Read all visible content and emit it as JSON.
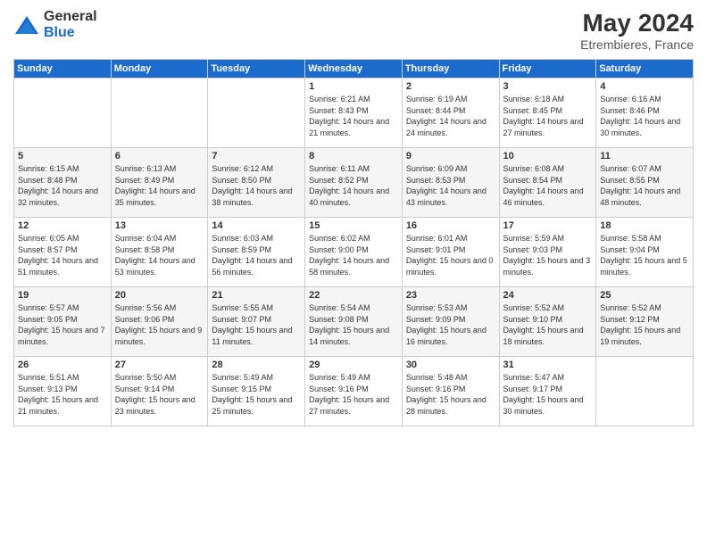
{
  "logo": {
    "general": "General",
    "blue": "Blue"
  },
  "header": {
    "month": "May 2024",
    "location": "Etrembieres, France"
  },
  "weekdays": [
    "Sunday",
    "Monday",
    "Tuesday",
    "Wednesday",
    "Thursday",
    "Friday",
    "Saturday"
  ],
  "weeks": [
    {
      "days": [
        {
          "num": "",
          "info": ""
        },
        {
          "num": "",
          "info": ""
        },
        {
          "num": "",
          "info": ""
        },
        {
          "num": "1",
          "info": "Sunrise: 6:21 AM\nSunset: 8:43 PM\nDaylight: 14 hours\nand 21 minutes."
        },
        {
          "num": "2",
          "info": "Sunrise: 6:19 AM\nSunset: 8:44 PM\nDaylight: 14 hours\nand 24 minutes."
        },
        {
          "num": "3",
          "info": "Sunrise: 6:18 AM\nSunset: 8:45 PM\nDaylight: 14 hours\nand 27 minutes."
        },
        {
          "num": "4",
          "info": "Sunrise: 6:16 AM\nSunset: 8:46 PM\nDaylight: 14 hours\nand 30 minutes."
        }
      ]
    },
    {
      "days": [
        {
          "num": "5",
          "info": "Sunrise: 6:15 AM\nSunset: 8:48 PM\nDaylight: 14 hours\nand 32 minutes."
        },
        {
          "num": "6",
          "info": "Sunrise: 6:13 AM\nSunset: 8:49 PM\nDaylight: 14 hours\nand 35 minutes."
        },
        {
          "num": "7",
          "info": "Sunrise: 6:12 AM\nSunset: 8:50 PM\nDaylight: 14 hours\nand 38 minutes."
        },
        {
          "num": "8",
          "info": "Sunrise: 6:11 AM\nSunset: 8:52 PM\nDaylight: 14 hours\nand 40 minutes."
        },
        {
          "num": "9",
          "info": "Sunrise: 6:09 AM\nSunset: 8:53 PM\nDaylight: 14 hours\nand 43 minutes."
        },
        {
          "num": "10",
          "info": "Sunrise: 6:08 AM\nSunset: 8:54 PM\nDaylight: 14 hours\nand 46 minutes."
        },
        {
          "num": "11",
          "info": "Sunrise: 6:07 AM\nSunset: 8:55 PM\nDaylight: 14 hours\nand 48 minutes."
        }
      ]
    },
    {
      "days": [
        {
          "num": "12",
          "info": "Sunrise: 6:05 AM\nSunset: 8:57 PM\nDaylight: 14 hours\nand 51 minutes."
        },
        {
          "num": "13",
          "info": "Sunrise: 6:04 AM\nSunset: 8:58 PM\nDaylight: 14 hours\nand 53 minutes."
        },
        {
          "num": "14",
          "info": "Sunrise: 6:03 AM\nSunset: 8:59 PM\nDaylight: 14 hours\nand 56 minutes."
        },
        {
          "num": "15",
          "info": "Sunrise: 6:02 AM\nSunset: 9:00 PM\nDaylight: 14 hours\nand 58 minutes."
        },
        {
          "num": "16",
          "info": "Sunrise: 6:01 AM\nSunset: 9:01 PM\nDaylight: 15 hours\nand 0 minutes."
        },
        {
          "num": "17",
          "info": "Sunrise: 5:59 AM\nSunset: 9:03 PM\nDaylight: 15 hours\nand 3 minutes."
        },
        {
          "num": "18",
          "info": "Sunrise: 5:58 AM\nSunset: 9:04 PM\nDaylight: 15 hours\nand 5 minutes."
        }
      ]
    },
    {
      "days": [
        {
          "num": "19",
          "info": "Sunrise: 5:57 AM\nSunset: 9:05 PM\nDaylight: 15 hours\nand 7 minutes."
        },
        {
          "num": "20",
          "info": "Sunrise: 5:56 AM\nSunset: 9:06 PM\nDaylight: 15 hours\nand 9 minutes."
        },
        {
          "num": "21",
          "info": "Sunrise: 5:55 AM\nSunset: 9:07 PM\nDaylight: 15 hours\nand 11 minutes."
        },
        {
          "num": "22",
          "info": "Sunrise: 5:54 AM\nSunset: 9:08 PM\nDaylight: 15 hours\nand 14 minutes."
        },
        {
          "num": "23",
          "info": "Sunrise: 5:53 AM\nSunset: 9:09 PM\nDaylight: 15 hours\nand 16 minutes."
        },
        {
          "num": "24",
          "info": "Sunrise: 5:52 AM\nSunset: 9:10 PM\nDaylight: 15 hours\nand 18 minutes."
        },
        {
          "num": "25",
          "info": "Sunrise: 5:52 AM\nSunset: 9:12 PM\nDaylight: 15 hours\nand 19 minutes."
        }
      ]
    },
    {
      "days": [
        {
          "num": "26",
          "info": "Sunrise: 5:51 AM\nSunset: 9:13 PM\nDaylight: 15 hours\nand 21 minutes."
        },
        {
          "num": "27",
          "info": "Sunrise: 5:50 AM\nSunset: 9:14 PM\nDaylight: 15 hours\nand 23 minutes."
        },
        {
          "num": "28",
          "info": "Sunrise: 5:49 AM\nSunset: 9:15 PM\nDaylight: 15 hours\nand 25 minutes."
        },
        {
          "num": "29",
          "info": "Sunrise: 5:49 AM\nSunset: 9:16 PM\nDaylight: 15 hours\nand 27 minutes."
        },
        {
          "num": "30",
          "info": "Sunrise: 5:48 AM\nSunset: 9:16 PM\nDaylight: 15 hours\nand 28 minutes."
        },
        {
          "num": "31",
          "info": "Sunrise: 5:47 AM\nSunset: 9:17 PM\nDaylight: 15 hours\nand 30 minutes."
        },
        {
          "num": "",
          "info": ""
        }
      ]
    }
  ]
}
